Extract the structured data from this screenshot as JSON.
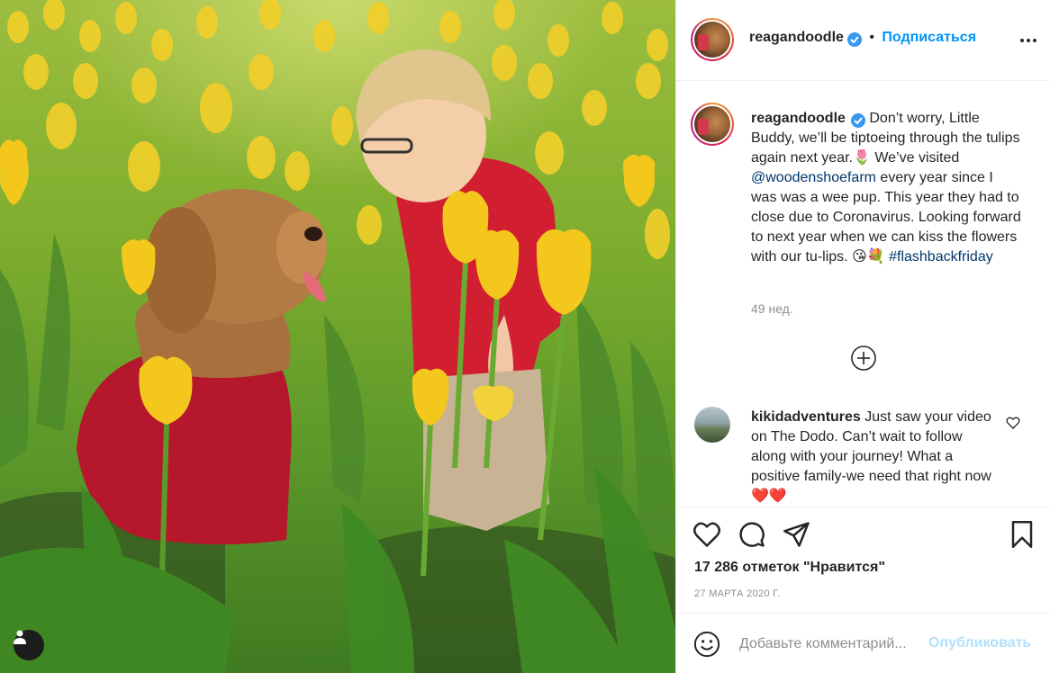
{
  "post": {
    "image_alt": "",
    "photo_subjects": [
      "dog-in-red-sweater",
      "boy-in-red-shirt",
      "yellow-tulips"
    ]
  },
  "header": {
    "username": "reagandoodle",
    "separator": "•",
    "follow_label": "Подписаться",
    "verified_icon": "verified-badge-icon",
    "more_icon": "more-options-icon"
  },
  "caption": {
    "username": "reagandoodle",
    "text_1": "Don’t worry, Little Buddy, we’ll be tiptoeing through the tulips again next year.🌷 We’ve visited ",
    "mention": "@woodenshoefarm",
    "text_2": " every year since I was was a wee pup. This year they had to close due to Coronavirus. Looking forward to next year when we can kiss the flowers with our tu-lips. 😘💐",
    "hashtag": "#flashbackfriday",
    "time_ago": "49 нед."
  },
  "load_more_icon": "plus-circle-icon",
  "comment": {
    "username": "kikidadventures",
    "text": "Just saw your video on The Dodo. Can’t wait to follow along with your journey! What a positive family-we need that right now ❤️❤️",
    "like_icon": "heart-outline-icon"
  },
  "actions": {
    "like_icon": "heart-icon",
    "comment_icon": "comment-icon",
    "share_icon": "share-icon",
    "save_icon": "bookmark-icon",
    "likes_text": "17 286 отметок \"Нравится\"",
    "date_text": "27 МАРТА 2020 Г."
  },
  "add_comment": {
    "emoji_icon": "emoji-icon",
    "placeholder": "Добавьте комментарий...",
    "publish_label": "Опубликовать"
  },
  "colors": {
    "link": "#00376b",
    "follow": "#0095f6",
    "publish_disabled": "#b2dffc",
    "muted": "#8e8e8e"
  }
}
